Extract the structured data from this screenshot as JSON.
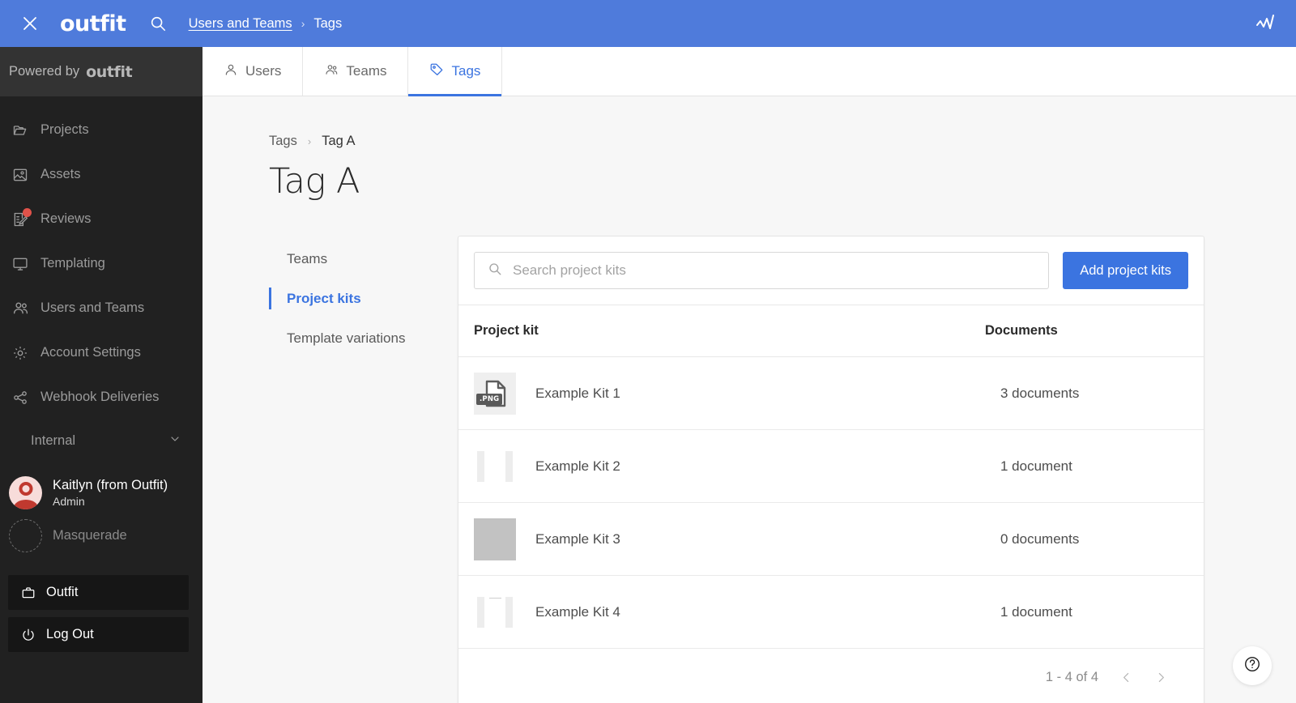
{
  "topbar": {
    "close_icon": "close-icon",
    "logo": "outfit",
    "search_icon": "search-icon",
    "breadcrumb_link": "Users and Teams",
    "breadcrumb_sep": "›",
    "breadcrumb_current": "Tags",
    "right_icon": "activity-chart-icon"
  },
  "sidebar": {
    "powered_by_text": "Powered by",
    "powered_by_logo": "outfit",
    "items": [
      {
        "label": "Projects",
        "icon": "folder-icon",
        "badge": false
      },
      {
        "label": "Assets",
        "icon": "image-icon",
        "badge": false
      },
      {
        "label": "Reviews",
        "icon": "review-edit-icon",
        "badge": true
      },
      {
        "label": "Templating",
        "icon": "monitor-icon",
        "badge": false
      },
      {
        "label": "Users and Teams",
        "icon": "users-icon",
        "badge": false
      },
      {
        "label": "Account Settings",
        "icon": "gear-icon",
        "badge": false
      },
      {
        "label": "Webhook Deliveries",
        "icon": "share-nodes-icon",
        "badge": false
      }
    ],
    "group": {
      "label": "Internal",
      "chevron": "chevron-down-icon"
    },
    "user": {
      "name": "Kaitlyn (from Outfit)",
      "role": "Admin"
    },
    "masquerade": "Masquerade",
    "buttons": [
      {
        "label": "Outfit",
        "icon": "briefcase-icon"
      },
      {
        "label": "Log Out",
        "icon": "power-icon"
      }
    ]
  },
  "tabs": [
    {
      "label": "Users",
      "icon": "user-icon",
      "active": false
    },
    {
      "label": "Teams",
      "icon": "teams-icon",
      "active": false
    },
    {
      "label": "Tags",
      "icon": "tag-icon",
      "active": true
    }
  ],
  "page": {
    "breadcrumb_root": "Tags",
    "breadcrumb_sep": "›",
    "breadcrumb_current": "Tag A",
    "title": "Tag A"
  },
  "subnav": [
    {
      "label": "Teams",
      "active": false
    },
    {
      "label": "Project kits",
      "active": true
    },
    {
      "label": "Template variations",
      "active": false
    }
  ],
  "panel": {
    "search_placeholder": "Search project kits",
    "search_value": "",
    "search_icon": "search-icon",
    "add_button": "Add project kits",
    "columns": {
      "kit": "Project kit",
      "documents": "Documents"
    },
    "rows": [
      {
        "name": "Example Kit 1",
        "documents": "3 documents",
        "thumb": "png-file-icon",
        "thumb_label": ".PNG"
      },
      {
        "name": "Example Kit 2",
        "documents": "1 document",
        "thumb": "bars-thumbnail"
      },
      {
        "name": "Example Kit 3",
        "documents": "0 documents",
        "thumb": "solid-grey-thumbnail"
      },
      {
        "name": "Example Kit 4",
        "documents": "1 document",
        "thumb": "bars-tick-thumbnail"
      }
    ],
    "pagination": {
      "range": "1 - 4 of 4",
      "prev_icon": "chevron-left-icon",
      "next_icon": "chevron-right-icon"
    }
  },
  "help": {
    "icon": "question-circle-icon"
  },
  "colors": {
    "header_blue": "#4f7bdb",
    "accent_blue": "#3b74e0",
    "sidebar_bg": "#212121",
    "sidebar_head_bg": "#333333",
    "main_bg": "#f7f7f7",
    "badge_red": "#e0524a"
  }
}
